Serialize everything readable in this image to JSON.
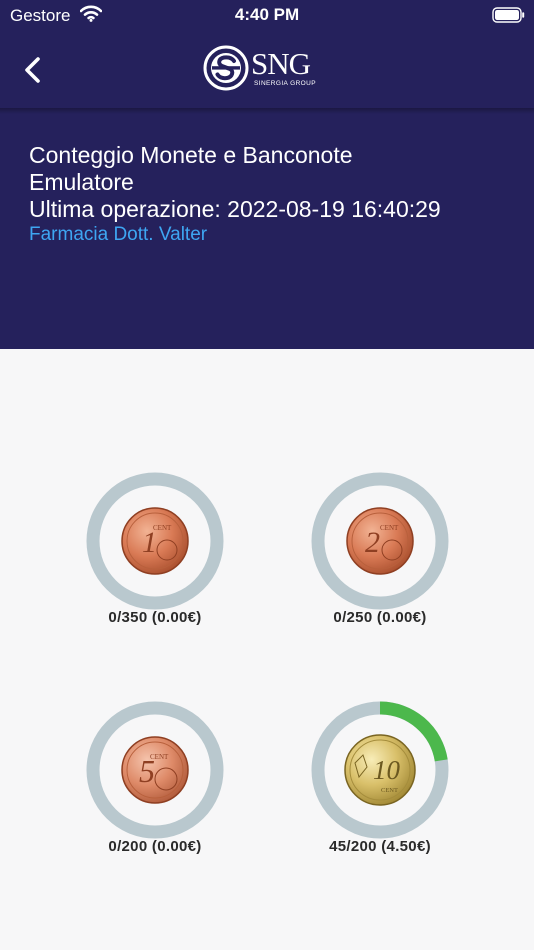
{
  "status_bar": {
    "carrier": "Gestore",
    "time": "4:40 PM"
  },
  "nav": {
    "logo": {
      "brand": "SNG",
      "subtitle": "SINERGIA GROUP"
    }
  },
  "info": {
    "line1": "Conteggio Monete e Banconote",
    "line2": "Emulatore",
    "line3": "Ultima operazione: 2022-08-19 16:40:29",
    "pharmacy": "Farmacia Dott. Valter"
  },
  "coins": [
    {
      "value_text": "1",
      "unit_text": "CENT",
      "label": "0/350 (0.00€)",
      "count": 0,
      "capacity": 350,
      "fill_fraction": 0.0,
      "metal": "copper"
    },
    {
      "value_text": "2",
      "unit_text": "CENT",
      "label": "0/250 (0.00€)",
      "count": 0,
      "capacity": 250,
      "fill_fraction": 0.0,
      "metal": "copper"
    },
    {
      "value_text": "5",
      "unit_text": "CENT",
      "label": "0/200 (0.00€)",
      "count": 0,
      "capacity": 200,
      "fill_fraction": 0.0,
      "metal": "copper"
    },
    {
      "value_text": "10",
      "unit_text": "CENT",
      "label": "45/200 (4.50€)",
      "count": 45,
      "capacity": 200,
      "fill_fraction": 0.225,
      "metal": "gold"
    }
  ],
  "colors": {
    "header_bg": "#25215c",
    "page_bg": "#f7f7f8",
    "ring_track": "#b9c8ce",
    "ring_progress": "#4cb84c",
    "link": "#3ea6f2"
  }
}
